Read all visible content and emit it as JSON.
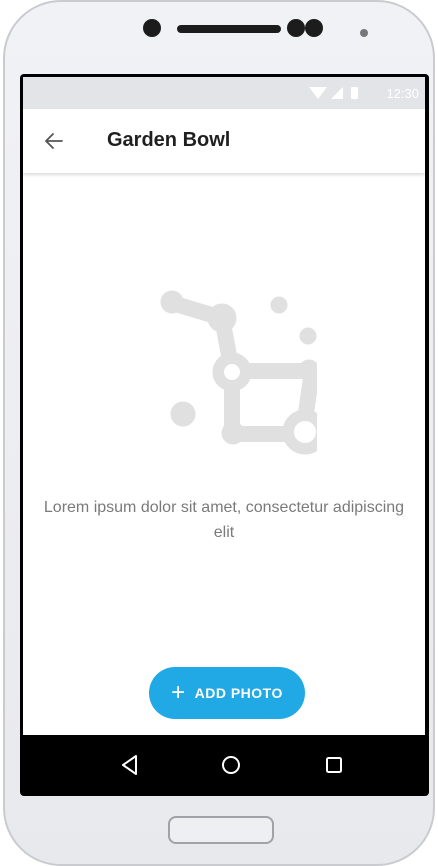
{
  "status_bar": {
    "time": "12:30"
  },
  "app_bar": {
    "title": "Garden Bowl",
    "back_icon": "arrow-back-icon"
  },
  "empty_state": {
    "icon": "constellation-illustration",
    "message": "Lorem ipsum dolor sit amet, consectetur adipiscing elit"
  },
  "fab": {
    "icon": "plus-icon",
    "label": "ADD PHOTO"
  },
  "nav_bar": {
    "back": "triangle-back-icon",
    "home": "circle-home-icon",
    "recents": "square-recents-icon"
  },
  "colors": {
    "accent": "#21a9e6",
    "illustration": "#e0e0e0",
    "text_secondary": "#7a7a7a"
  }
}
